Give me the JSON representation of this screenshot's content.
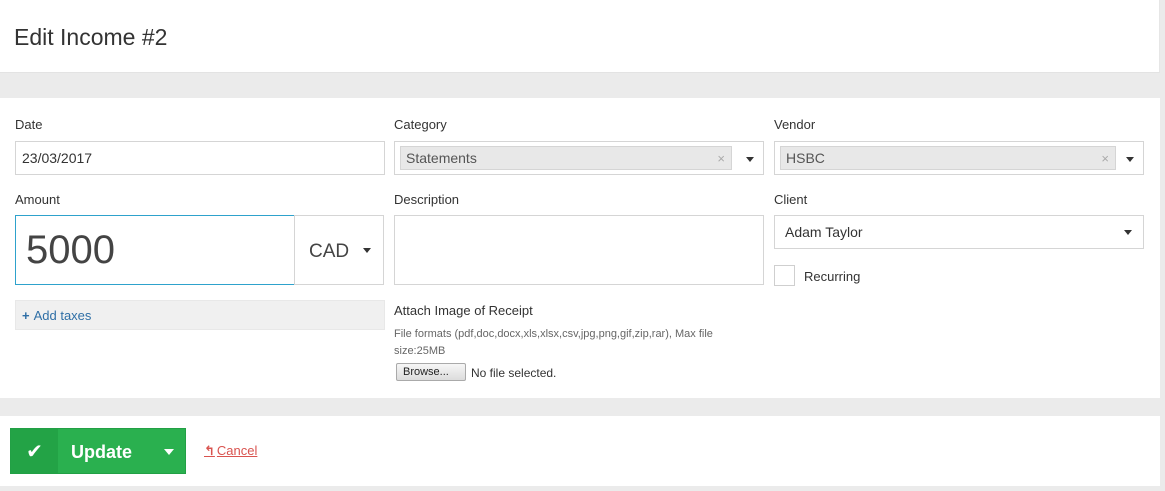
{
  "page": {
    "title": "Edit Income #2"
  },
  "form": {
    "date": {
      "label": "Date",
      "value": "23/03/2017"
    },
    "category": {
      "label": "Category",
      "value": "Statements",
      "clear": "×"
    },
    "vendor": {
      "label": "Vendor",
      "value": "HSBC",
      "clear": "×"
    },
    "amount": {
      "label": "Amount",
      "value": "5000",
      "currency": "CAD"
    },
    "description": {
      "label": "Description",
      "value": ""
    },
    "client": {
      "label": "Client",
      "value": "Adam Taylor"
    },
    "recurring": {
      "label": "Recurring",
      "checked": false
    },
    "add_taxes": {
      "label": "Add taxes",
      "icon": "+"
    },
    "attachment": {
      "label": "Attach Image of Receipt",
      "hint_line1": "File formats (pdf,doc,docx,xls,xlsx,csv,jpg,png,gif,zip,rar), Max file",
      "hint_line2": "size:25MB",
      "browse_label": "Browse...",
      "status": "No file selected."
    }
  },
  "actions": {
    "update_label": "Update",
    "cancel_label": "Cancel",
    "cancel_icon": "↰"
  },
  "colors": {
    "accent_blue": "#2ea2cc",
    "success_green": "#2ab04f",
    "danger_red": "#d9534f",
    "link_blue": "#2f6fa6"
  }
}
